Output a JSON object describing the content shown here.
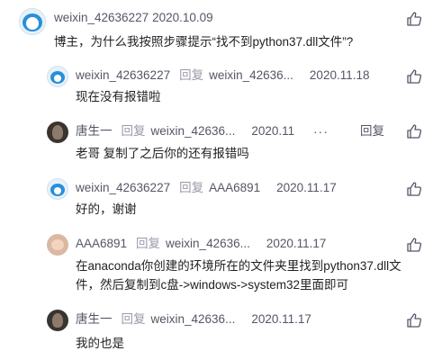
{
  "comments": [
    {
      "user": "weixin_42636227",
      "date": "2020.10.09",
      "text": "博主，为什么我按照步骤提示“找不到python37.dll文件”?",
      "avatar": "doraemon-avatar",
      "replies": [
        {
          "user": "weixin_42636227",
          "reply_word": "回复",
          "target": "weixin_42636...",
          "date": "2020.11.18",
          "text": "现在没有报错啦",
          "avatar": "doraemon-avatar"
        },
        {
          "user": "唐生一",
          "reply_word": "回复",
          "target": "weixin_42636...",
          "date": "2020.11",
          "more": "···",
          "reply_button": "回复",
          "text": "老哥 复制了之后你的还有报错吗",
          "avatar": "dark-photo-avatar"
        },
        {
          "user": "weixin_42636227",
          "reply_word": "回复",
          "target": "AAA6891",
          "date": "2020.11.17",
          "text": "好的，谢谢",
          "avatar": "doraemon-avatar"
        },
        {
          "user": "AAA6891",
          "reply_word": "回复",
          "target": "weixin_42636...",
          "date": "2020.11.17",
          "text_line1": "在anaconda你创建的环境所在的文件夹里找到python37.dll文",
          "text_line2": "件，然后复制到c盘->windows->system32里面即可",
          "avatar": "monkey-avatar"
        },
        {
          "user": "唐生一",
          "reply_word": "回复",
          "target": "weixin_42636...",
          "date": "2020.11.17",
          "text": "我的也是",
          "avatar": "dark-photo-avatar"
        }
      ]
    }
  ],
  "icons": {
    "like": "thumbs-up-icon"
  },
  "colors": {
    "username": "#555666",
    "reply_word": "#999aaa",
    "text": "#222226"
  }
}
